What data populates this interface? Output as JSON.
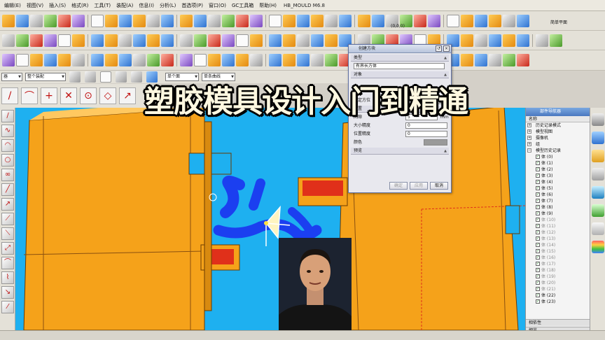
{
  "menu": {
    "items": [
      "编辑(E)",
      "视图(V)",
      "插入(S)",
      "格式(R)",
      "工具(T)",
      "装配(A)",
      "信息(I)",
      "分析(L)",
      "首选项(P)",
      "窗口(O)",
      "GC工具箱",
      "帮助(H)"
    ],
    "app_title": "HB_MOULD M6.8"
  },
  "toolbar": {
    "coord_label": "(0,0,0)",
    "menu_hint": "简单平面"
  },
  "selection_bar": {
    "filter_value": "器",
    "assembly_scope": "整个装配",
    "face_filter": "单个面",
    "curve_filter": "单条曲线"
  },
  "overlay_title": "塑胶模具设计入门到精通",
  "dialog": {
    "title": "创建方块",
    "type_group": "类型",
    "type_value": "有界长方体",
    "object_group": "对象",
    "csys_label": "指定方位",
    "settings_group": "设置",
    "fields": [
      {
        "label": "间隙",
        "value": "5",
        "unit": "mm"
      },
      {
        "label": "大小精度",
        "value": "0"
      },
      {
        "label": "位置精度",
        "value": "0"
      },
      {
        "label": "颜色",
        "value": ""
      }
    ],
    "preview_group": "预览",
    "buttons": {
      "ok": "确定",
      "apply": "应用",
      "cancel": "取消"
    }
  },
  "navigator": {
    "title": "部件导航器",
    "column_name": "名称",
    "roots": [
      "历史记录模式",
      "模型视图",
      "摄像机",
      "组",
      "模型历史记录"
    ],
    "features": [
      {
        "label": "体 (0)",
        "dim": false
      },
      {
        "label": "体 (1)",
        "dim": false
      },
      {
        "label": "体 (2)",
        "dim": false
      },
      {
        "label": "体 (3)",
        "dim": false
      },
      {
        "label": "体 (4)",
        "dim": false
      },
      {
        "label": "体 (5)",
        "dim": false
      },
      {
        "label": "体 (6)",
        "dim": false
      },
      {
        "label": "体 (7)",
        "dim": false
      },
      {
        "label": "体 (8)",
        "dim": false
      },
      {
        "label": "体 (9)",
        "dim": false
      },
      {
        "label": "体 (10)",
        "dim": true
      },
      {
        "label": "体 (11)",
        "dim": true
      },
      {
        "label": "体 (12)",
        "dim": true
      },
      {
        "label": "体 (13)",
        "dim": true
      },
      {
        "label": "体 (14)",
        "dim": true
      },
      {
        "label": "体 (15)",
        "dim": true
      },
      {
        "label": "体 (16)",
        "dim": true
      },
      {
        "label": "体 (17)",
        "dim": true
      },
      {
        "label": "体 (18)",
        "dim": true
      },
      {
        "label": "体 (19)",
        "dim": true
      },
      {
        "label": "体 (20)",
        "dim": true
      },
      {
        "label": "体 (21)",
        "dim": true
      },
      {
        "label": "体 (22)",
        "dim": false
      },
      {
        "label": "体 (23)",
        "dim": false
      }
    ],
    "sections": [
      "相依性",
      "细节"
    ]
  },
  "colors": {
    "viewport_bg": "#1eb0f0",
    "part_orange": "#f5a21a",
    "cooling_blue": "#1b3ff0",
    "cavity_red": "#e0301a"
  }
}
